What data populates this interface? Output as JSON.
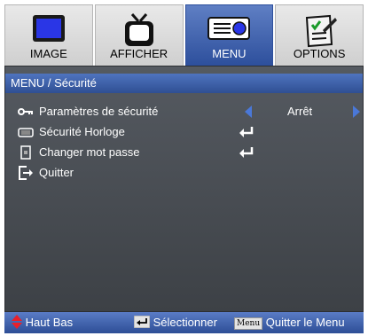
{
  "tabs": [
    {
      "label": "IMAGE",
      "icon": "display-icon",
      "active": false
    },
    {
      "label": "AFFICHER",
      "icon": "tv-icon",
      "active": false
    },
    {
      "label": "MENU",
      "icon": "projector-icon",
      "active": true
    },
    {
      "label": "OPTIONS",
      "icon": "checklist-icon",
      "active": false
    }
  ],
  "breadcrumb": "MENU / Sécurité",
  "items": [
    {
      "label": "Paramètres de sécurité",
      "icon": "key-icon",
      "value": "Arrêt"
    },
    {
      "label": "Sécurité Horloge",
      "icon": "timer-icon",
      "action": "enter-icon"
    },
    {
      "label": "Changer mot passe",
      "icon": "password-icon",
      "action": "enter-icon"
    },
    {
      "label": "Quitter",
      "icon": "exit-icon"
    }
  ],
  "statusbar": {
    "nav_label": "Haut Bas",
    "select_label": "Sélectionner",
    "menu_key": "Menu",
    "quit_label": "Quitter le Menu"
  },
  "colors": {
    "accent_blue": "#2f4f93",
    "active_tab": "#3d5fad",
    "panel_bg": "#4a4e54",
    "arrow_blue": "#4a78d8",
    "nav_red": "#e8202a"
  }
}
